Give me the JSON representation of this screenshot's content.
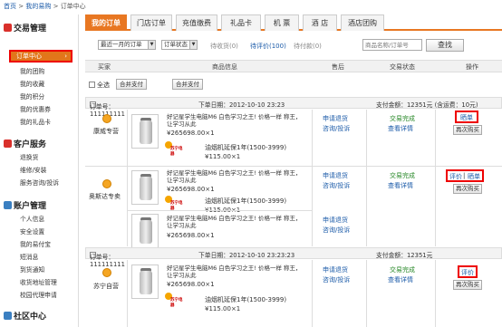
{
  "breadcrumb": {
    "home": "首页",
    "sep1": ">",
    "mine": "我的易购",
    "sep2": ">",
    "current": "订单中心"
  },
  "sidebar": {
    "sections": [
      {
        "title": "交易管理",
        "icon": "transaction-icon",
        "color": "#d9302b"
      },
      {
        "title": "客户服务",
        "icon": "service-icon",
        "color": "#d9302b"
      },
      {
        "title": "账户管理",
        "icon": "account-icon",
        "color": "#3a7fc1"
      },
      {
        "title": "社区中心",
        "icon": "community-icon",
        "color": "#3a7fc1"
      }
    ],
    "active": "订单中心",
    "active_arrow": "›",
    "trade_items": [
      "我的团购",
      "我的收藏",
      "我的积分",
      "我的优惠券",
      "我的礼品卡"
    ],
    "service_items": [
      "退换货",
      "维修/安装",
      "服务咨询/投诉"
    ],
    "account_items": [
      "个人信息",
      "安全设置",
      "我的易付宝",
      "短消息",
      "到货通知",
      "收货地址管理",
      "校园代理申请"
    ]
  },
  "tabs": [
    "我的订单",
    "门店订单",
    "充值缴费",
    "礼品卡",
    "机 票",
    "酒 店",
    "酒店团购"
  ],
  "filters": {
    "time_select": "最近一月的订单",
    "status_select": "订单状态",
    "pending_pay": "待收货(0)",
    "pending_review": "待评价(100)",
    "pending_pay2": "待付款(0)",
    "search_placeholder": "商品名称/订单号",
    "search_button": "查找"
  },
  "table_header": {
    "buyer": "买家",
    "product": "商品信息",
    "after_sale": "售后",
    "status": "交易状态",
    "action": "操作"
  },
  "bulk": {
    "select_all": "全选",
    "merge_pay1": "合并支付",
    "merge_pay2": "合并支付"
  },
  "orders": [
    {
      "order_no": "订单号：111111111",
      "date": "下单日期：2012-10-10 23:23",
      "amount": "支付金额：12351元 (含运费：10元)",
      "seller": "康威专营",
      "product": "好记星学生电脑M6 白色学习之王! 价格一样 称王，让学习从此",
      "price": "¥265698.00×1",
      "gift": "油烟机延保1年(1500-3999)",
      "gift_price": "¥115.00×1",
      "after1": "申请退货",
      "after2": "咨询/投诉",
      "status": "交易完成",
      "detail": "查看详情",
      "action_primary": "晒单",
      "action_secondary": "再次购买"
    },
    {
      "seller": "奥斯达专卖",
      "products": [
        {
          "name": "好记星学生电脑M6 白色学习之王! 价格一样 称王，让学习从此",
          "price": "¥265698.00×1",
          "gift": "油烟机延保1年(1500-3999)",
          "gift_price": "¥115.00×1"
        },
        {
          "name": "好记星学生电脑M6 白色学习之王! 价格一样 称王，让学习从此",
          "price": "¥265698.00×1"
        }
      ],
      "after1": "申请退货",
      "after2": "咨询/投诉",
      "after3": "申请退货",
      "after4": "咨询/投诉",
      "status": "交易完成",
      "detail": "查看详情",
      "action_primary_a": "评价",
      "action_sep": "|",
      "action_primary_b": "晒单",
      "action_secondary": "再次购买"
    },
    {
      "order_no": "订单号：111111111",
      "date": "下单日期：2012-10-10 23:23:23",
      "amount": "支付金额：12351元",
      "seller": "苏宁自营",
      "product": "好记星学生电脑M6 白色学习之王! 价格一样 称王，让学习从此",
      "price": "¥265698.00×1",
      "gift": "油烟机延保1年(1500-3999)",
      "gift_price": "¥115.00×1",
      "after1": "申请退货",
      "after2": "咨询/投诉",
      "status": "交易完成",
      "detail": "查看详情",
      "action_primary": "评价",
      "action_secondary": "再次购买"
    }
  ],
  "brand_logo_text": "苏宁电器",
  "colors": {
    "accent": "#e87722",
    "link": "#1a5aa8",
    "highlight_border": "#e00000"
  }
}
